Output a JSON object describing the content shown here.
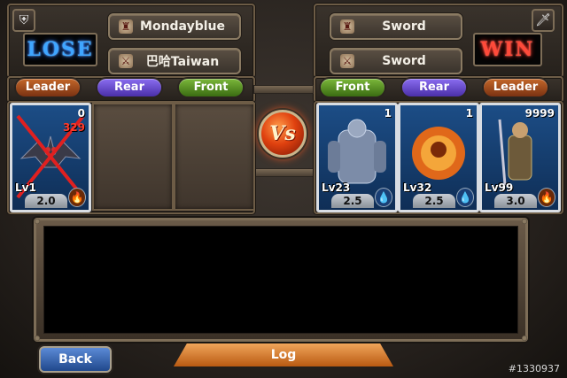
{
  "left_player": {
    "result": "LOSE",
    "name": "Mondayblue",
    "guild": "巴哈Taiwan",
    "icon": "shield-icon",
    "positions": {
      "leader": "Leader",
      "rear": "Rear",
      "front": "Front"
    },
    "cards": [
      {
        "slot": "leader",
        "count": "0",
        "damage": "329",
        "level": "Lv1",
        "cost": "2.0",
        "defeated": true,
        "element": "fire"
      }
    ]
  },
  "right_player": {
    "result": "WIN",
    "name": "Sword",
    "guild": "Sword",
    "icon": "sword-icon",
    "positions": {
      "front": "Front",
      "rear": "Rear",
      "leader": "Leader"
    },
    "cards": [
      {
        "slot": "front",
        "count": "1",
        "level": "Lv23",
        "cost": "2.5",
        "element": "water"
      },
      {
        "slot": "rear",
        "count": "1",
        "level": "Lv32",
        "cost": "2.5",
        "element": "water"
      },
      {
        "slot": "leader",
        "count": "9999",
        "level": "Lv99",
        "cost": "3.0",
        "element": "fire"
      }
    ]
  },
  "vs_label": "Vs",
  "buttons": {
    "back": "Back",
    "log": "Log"
  },
  "watermark": "#1330937",
  "colors": {
    "lose": "#3fa6ff",
    "win": "#ff4a3a",
    "leader": "#c4672a",
    "rear": "#6a4fd6",
    "front": "#5a9a22"
  }
}
